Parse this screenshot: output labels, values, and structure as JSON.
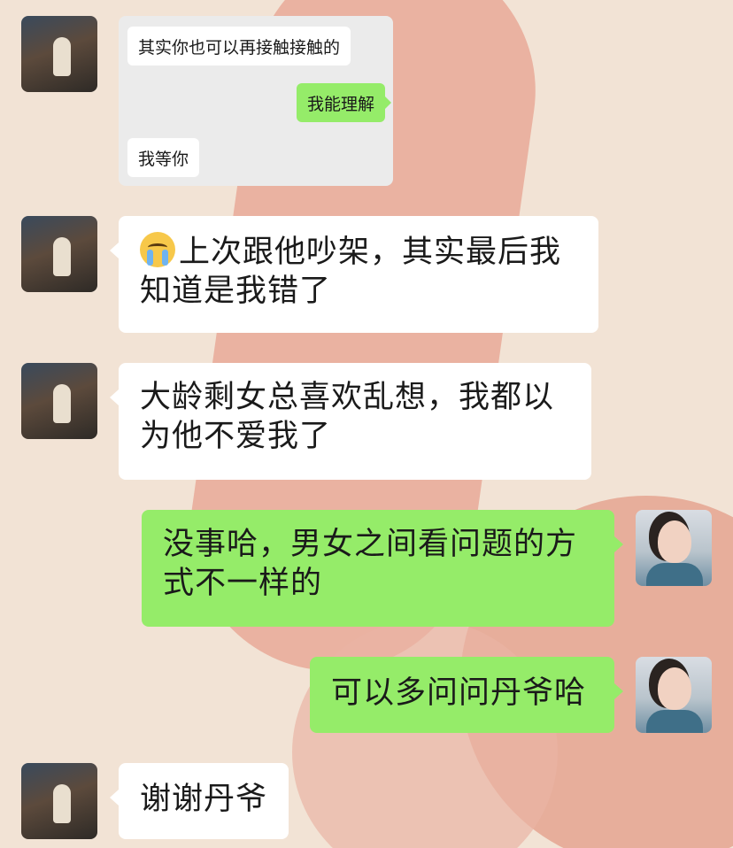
{
  "messages": [
    {
      "sender": "friend",
      "quote": {
        "lines": [
          {
            "side": "left",
            "text": "其实你也可以再接触接触的"
          },
          {
            "side": "right",
            "text": "我能理解"
          },
          {
            "side": "left",
            "text": "我等你"
          }
        ]
      }
    },
    {
      "sender": "friend",
      "emoji": "crying-face-emoji",
      "line1": "上次跟他吵架，其实最后我",
      "line2": "知道是我错了"
    },
    {
      "sender": "friend",
      "line1": "大龄剩女总喜欢乱想，我都以",
      "line2": "为他不爱我了"
    },
    {
      "sender": "me",
      "line1": "没事哈，男女之间看问题的方",
      "line2": "式不一样的"
    },
    {
      "sender": "me",
      "line1": "可以多问问丹爷哈"
    },
    {
      "sender": "friend",
      "line1": "谢谢丹爷"
    }
  ],
  "colors": {
    "sent_bubble": "#95ec69",
    "received_bubble": "#ffffff",
    "quote_card": "#ebebeb",
    "background": "#f2e3d5"
  }
}
